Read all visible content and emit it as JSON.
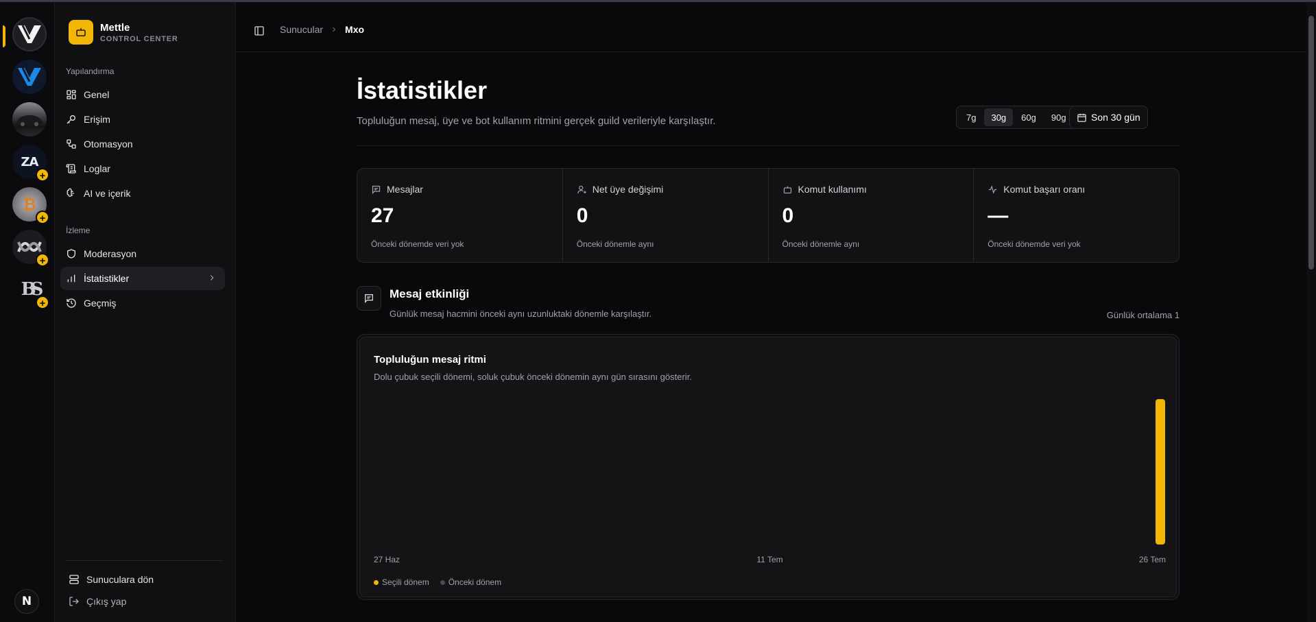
{
  "brand": {
    "name": "Mettle",
    "subtitle": "CONTROL CENTER"
  },
  "rail": {
    "servers": [
      {
        "name": "server-1",
        "active": true,
        "pending": false
      },
      {
        "name": "server-2",
        "active": false,
        "pending": false
      },
      {
        "name": "server-3",
        "active": false,
        "pending": false
      },
      {
        "name": "server-4",
        "initials": "ZA",
        "active": false,
        "pending": true
      },
      {
        "name": "server-5",
        "initials": "₿",
        "active": false,
        "pending": true
      },
      {
        "name": "server-6",
        "active": false,
        "pending": true
      },
      {
        "name": "server-7",
        "initials": "BS",
        "active": false,
        "pending": true
      }
    ],
    "plus_symbol": "+",
    "bottom_button": "N"
  },
  "nav": {
    "config_label": "Yapılandırma",
    "config_items": [
      {
        "label": "Genel",
        "icon": "grid-icon"
      },
      {
        "label": "Erişim",
        "icon": "key-icon"
      },
      {
        "label": "Otomasyon",
        "icon": "workflow-icon"
      },
      {
        "label": "Loglar",
        "icon": "scroll-icon"
      },
      {
        "label": "AI ve içerik",
        "icon": "brain-icon"
      }
    ],
    "monitor_label": "İzleme",
    "monitor_items": [
      {
        "label": "Moderasyon",
        "icon": "shield-icon"
      },
      {
        "label": "İstatistikler",
        "icon": "bar-chart-icon",
        "active": true
      },
      {
        "label": "Geçmiş",
        "icon": "history-icon"
      }
    ],
    "back_label": "Sunuculara dön",
    "logout_label": "Çıkış yap"
  },
  "header": {
    "breadcrumb_root": "Sunucular",
    "breadcrumb_current": "Mxo"
  },
  "page": {
    "title": "İstatistikler",
    "subtitle": "Topluluğun mesaj, üye ve bot kullanım ritmini gerçek guild verileriyle karşılaştır.",
    "range_options": [
      "7g",
      "30g",
      "60g",
      "90g"
    ],
    "range_selected": "30g",
    "date_button": "Son 30 gün"
  },
  "stats": [
    {
      "label": "Mesajlar",
      "value": "27",
      "note": "Önceki dönemde veri yok",
      "icon": "message-icon"
    },
    {
      "label": "Net üye değişimi",
      "value": "0",
      "note": "Önceki dönemle aynı",
      "icon": "user-plus-icon"
    },
    {
      "label": "Komut kullanımı",
      "value": "0",
      "note": "Önceki dönemle aynı",
      "icon": "bot-icon"
    },
    {
      "label": "Komut başarı oranı",
      "value": "—",
      "note": "Önceki dönemde veri yok",
      "icon": "activity-icon"
    }
  ],
  "activity": {
    "title": "Mesaj etkinliği",
    "subtitle": "Günlük mesaj hacmini önceki aynı uzunluktaki dönemle karşılaştır.",
    "daily_avg": "Günlük ortalama 1"
  },
  "chart_data": {
    "type": "bar",
    "title": "Topluluğun mesaj ritmi",
    "subtitle": "Dolu çubuk seçili dönemi, soluk çubuk önceki dönemin aynı gün sırasını gösterir.",
    "x_tick_labels": [
      "27 Haz",
      "11 Tem",
      "26 Tem"
    ],
    "categories_count": 30,
    "series": [
      {
        "name": "Seçili dönem",
        "color": "#f2b705",
        "values": [
          0,
          0,
          0,
          0,
          0,
          0,
          0,
          0,
          0,
          0,
          0,
          0,
          0,
          0,
          0,
          0,
          0,
          0,
          0,
          0,
          0,
          0,
          0,
          0,
          0,
          0,
          0,
          0,
          0,
          27
        ]
      },
      {
        "name": "Önceki dönem",
        "color": "#4a4a50",
        "values": [
          0,
          0,
          0,
          0,
          0,
          0,
          0,
          0,
          0,
          0,
          0,
          0,
          0,
          0,
          0,
          0,
          0,
          0,
          0,
          0,
          0,
          0,
          0,
          0,
          0,
          0,
          0,
          0,
          0,
          0
        ]
      }
    ],
    "ylim": [
      0,
      27
    ],
    "grid": false,
    "legend": "bottom-left"
  },
  "colors": {
    "accent": "#f2b705",
    "background": "#09090b",
    "muted": "#a1a1aa"
  }
}
